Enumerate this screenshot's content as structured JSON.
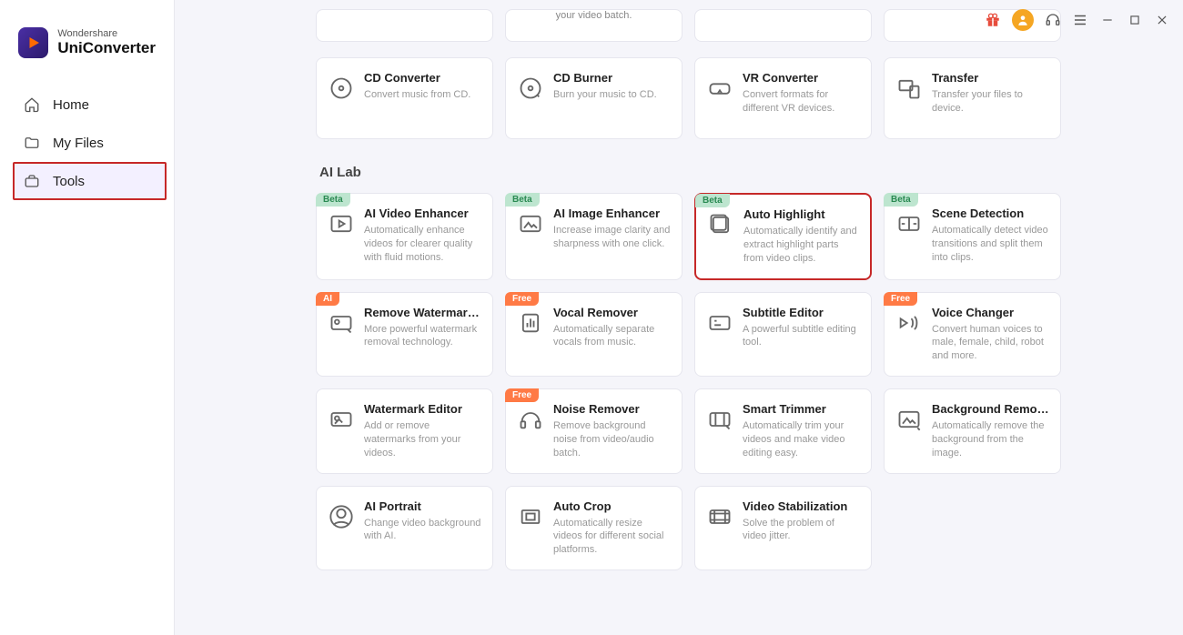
{
  "app": {
    "brand": "Wondershare",
    "product": "UniConverter"
  },
  "nav": {
    "home": "Home",
    "files": "My Files",
    "tools": "Tools"
  },
  "partial_last": "your video batch.",
  "row_cards": [
    {
      "title": "CD Converter",
      "desc": "Convert music from CD."
    },
    {
      "title": "CD Burner",
      "desc": "Burn your music to CD."
    },
    {
      "title": "VR Converter",
      "desc": "Convert formats for different VR devices."
    },
    {
      "title": "Transfer",
      "desc": "Transfer your files to device."
    }
  ],
  "ai_lab_title": "AI Lab",
  "badges": {
    "beta": "Beta",
    "ai": "AI",
    "free": "Free"
  },
  "ai_cards": [
    {
      "badge": "beta",
      "title": "AI Video Enhancer",
      "desc": "Automatically enhance videos for clearer quality with fluid motions."
    },
    {
      "badge": "beta",
      "title": "AI Image Enhancer",
      "desc": "Increase image clarity and sharpness with one click."
    },
    {
      "badge": "beta",
      "title": "Auto Highlight",
      "desc": "Automatically identify and extract highlight parts from video clips.",
      "highlight": true
    },
    {
      "badge": "beta",
      "title": "Scene Detection",
      "desc": "Automatically detect video transitions and split them into clips."
    },
    {
      "badge": "ai",
      "title": "Remove Watermark ...",
      "desc": "More powerful watermark removal technology."
    },
    {
      "badge": "free",
      "title": "Vocal Remover",
      "desc": "Automatically separate vocals from music."
    },
    {
      "badge": null,
      "title": "Subtitle Editor",
      "desc": "A powerful subtitle editing tool."
    },
    {
      "badge": "free",
      "title": "Voice Changer",
      "desc": "Convert human voices to male, female, child, robot and more."
    },
    {
      "badge": null,
      "title": "Watermark Editor",
      "desc": "Add or remove watermarks from your videos."
    },
    {
      "badge": "free",
      "title": "Noise Remover",
      "desc": "Remove background noise from video/audio batch."
    },
    {
      "badge": null,
      "title": "Smart Trimmer",
      "desc": "Automatically trim your videos and make video editing easy."
    },
    {
      "badge": null,
      "title": "Background Remover",
      "desc": "Automatically remove the background from the image."
    },
    {
      "badge": null,
      "title": "AI Portrait",
      "desc": "Change video background with AI."
    },
    {
      "badge": null,
      "title": "Auto Crop",
      "desc": "Automatically resize videos for different social platforms."
    },
    {
      "badge": null,
      "title": "Video Stabilization",
      "desc": "Solve the problem of video jitter."
    }
  ]
}
